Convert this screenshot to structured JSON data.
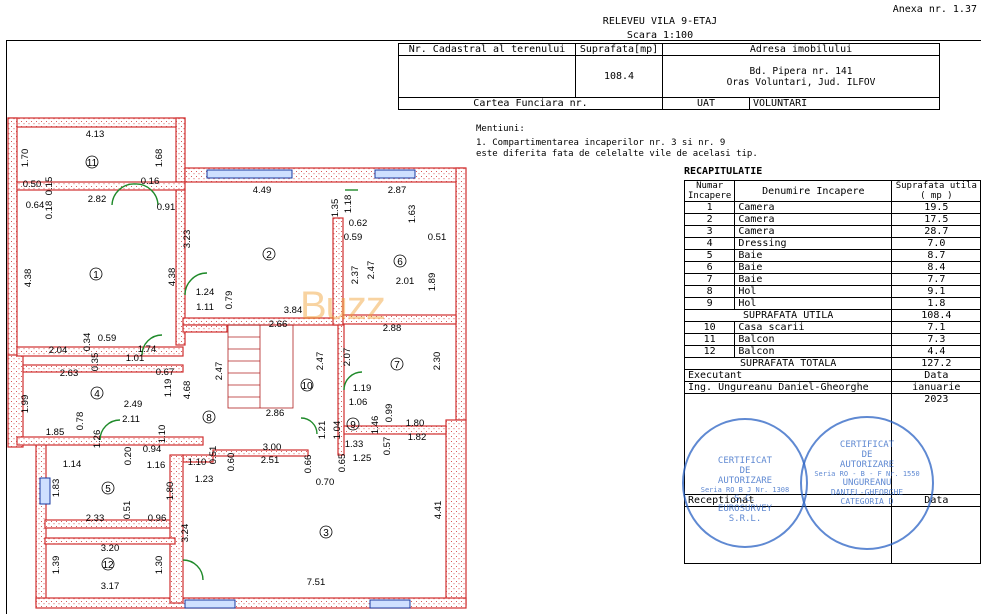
{
  "header": {
    "annex": "Anexa nr. 1.37",
    "title": "RELEVEU VILA 9-ETAJ",
    "scale": "Scara 1:100"
  },
  "cadastral": {
    "h_nr": "Nr. Cadastral al terenului",
    "h_area": "Suprafata[mp]",
    "h_address": "Adresa imobilului",
    "area": "108.4",
    "address_line1": "Bd. Pipera nr. 141",
    "address_line2": "Oras Voluntari, Jud. ILFOV",
    "carte": "Cartea Funciara nr.",
    "uat": "UAT",
    "uat_value": "VOLUNTARI"
  },
  "notes": {
    "title": "Mentiuni:",
    "line1": "1. Compartimentarea incaperilor nr. 3 si nr. 9",
    "line2": "este diferita fata de celelalte vile de acelasi tip."
  },
  "recap": {
    "title": "RECAPITULATIE",
    "h_num": "Numar Incapere",
    "h_name": "Denumire Incapere",
    "h_area": "Suprafata utila ( mp )",
    "rooms": [
      {
        "n": "1",
        "name": "Camera",
        "area": "19.5"
      },
      {
        "n": "2",
        "name": "Camera",
        "area": "17.5"
      },
      {
        "n": "3",
        "name": "Camera",
        "area": "28.7"
      },
      {
        "n": "4",
        "name": "Dressing",
        "area": "7.0"
      },
      {
        "n": "5",
        "name": "Baie",
        "area": "8.7"
      },
      {
        "n": "6",
        "name": "Baie",
        "area": "8.4"
      },
      {
        "n": "7",
        "name": "Baie",
        "area": "7.7"
      },
      {
        "n": "8",
        "name": "Hol",
        "area": "9.1"
      },
      {
        "n": "9",
        "name": "Hol",
        "area": "1.8"
      }
    ],
    "util_label": "SUPRAFATA UTILA",
    "util_value": "108.4",
    "extra": [
      {
        "n": "10",
        "name": "Casa scarii",
        "area": "7.1"
      },
      {
        "n": "11",
        "name": "Balcon",
        "area": "7.3"
      },
      {
        "n": "12",
        "name": "Balcon",
        "area": "4.4"
      }
    ],
    "total_label": "SUPRAFATA TOTALA",
    "total_value": "127.2",
    "executant": "Executant",
    "data": "Data",
    "engineer": "Ing. Ungureanu Daniel-Gheorghe",
    "month": "ianuarie",
    "year": "2023",
    "receptionat": "Receptionat",
    "data2": "Data"
  },
  "stamps": {
    "s1_line1": "CERTIFICAT",
    "s1_line2": "DE",
    "s1_line3": "AUTORIZARE",
    "s1_series": "Seria RO B J Nr. 1308",
    "s1_company1": "S.C.",
    "s1_company2": "EUROSURVEY",
    "s1_company3": "S.R.L.",
    "s2_line1": "CERTIFICAT",
    "s2_line2": "DE",
    "s2_line3": "AUTORIZARE",
    "s2_series": "Seria RO - B - F Nr. 1550",
    "s2_name1": "UNGUREANU",
    "s2_name2": "DANIEL-GHEORGHE",
    "s2_cat": "CATEGORIA D"
  },
  "watermark": "Buzz",
  "plan": {
    "room_numbers": [
      "1",
      "2",
      "3",
      "4",
      "5",
      "6",
      "7",
      "8",
      "9",
      "10",
      "11",
      "12"
    ],
    "dimensions": [
      "4.13",
      "1.70",
      "1.68",
      "0.50",
      "0.15",
      "0.16",
      "0.64",
      "0.18",
      "2.82",
      "0.91",
      "4.49",
      "2.87",
      "1.35",
      "1.18",
      "0.62",
      "0.59",
      "1.63",
      "0.51",
      "3.23",
      "4.38",
      "4.38",
      "2.37",
      "2.47",
      "2.01",
      "1.89",
      "1.24",
      "1.11",
      "0.79",
      "3.84",
      "2.88",
      "2.66",
      "2.04",
      "0.34",
      "0.59",
      "0.35",
      "1.74",
      "1.01",
      "2.63",
      "0.67",
      "1.19",
      "2.47",
      "2.47",
      "2.07",
      "2.30",
      "4.68",
      "1.99",
      "1.85",
      "0.78",
      "1.26",
      "2.49",
      "2.11",
      "1.19",
      "1.06",
      "1.46",
      "0.99",
      "2.86",
      "1.21",
      "1.04",
      "1.33",
      "1.80",
      "1.82",
      "0.94",
      "1.10",
      "0.20",
      "0.57",
      "1.14",
      "1.16",
      "3.00",
      "1.10",
      "0.51",
      "0.60",
      "2.51",
      "0.66",
      "0.65",
      "1.25",
      "1.23",
      "0.70",
      "1.83",
      "1.80",
      "2.33",
      "0.51",
      "0.96",
      "3.24",
      "4.41",
      "3.20",
      "1.39",
      "1.30",
      "3.17",
      "7.51"
    ]
  }
}
